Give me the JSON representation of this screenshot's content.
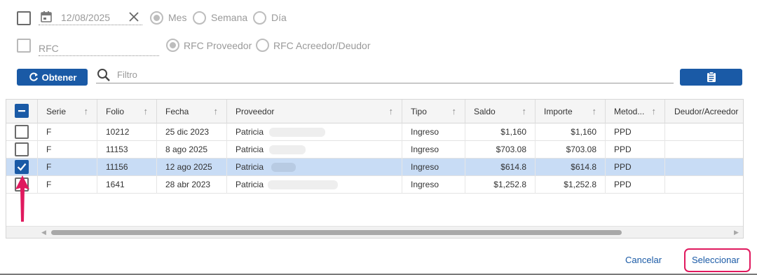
{
  "filters": {
    "date_value": "12/08/2025",
    "period_options": [
      "Mes",
      "Semana",
      "Día"
    ],
    "period_selected": "Mes",
    "rfc_placeholder": "RFC",
    "rfc_type_options": [
      "RFC Proveedor",
      "RFC Acreedor/Deudor"
    ],
    "rfc_type_selected": "RFC Proveedor"
  },
  "toolbar": {
    "obtener_label": "Obtener",
    "filter_placeholder": "Filtro"
  },
  "table": {
    "columns": [
      "Serie",
      "Folio",
      "Fecha",
      "Proveedor",
      "Tipo",
      "Saldo",
      "Importe",
      "Metod...",
      "Deudor/Acreedor"
    ],
    "rows": [
      {
        "checked": false,
        "serie": "F",
        "folio": "10212",
        "fecha": "25 dic 2023",
        "proveedor": "Patricia",
        "tipo": "Ingreso",
        "saldo": "$1,160",
        "importe": "$1,160",
        "metodo": "PPD"
      },
      {
        "checked": false,
        "serie": "F",
        "folio": "11153",
        "fecha": "8 ago 2025",
        "proveedor": "Patricia",
        "tipo": "Ingreso",
        "saldo": "$703.08",
        "importe": "$703.08",
        "metodo": "PPD"
      },
      {
        "checked": true,
        "serie": "F",
        "folio": "11156",
        "fecha": "12 ago 2025",
        "proveedor": "Patricia",
        "tipo": "Ingreso",
        "saldo": "$614.8",
        "importe": "$614.8",
        "metodo": "PPD"
      },
      {
        "checked": false,
        "serie": "F",
        "folio": "1641",
        "fecha": "28 abr 2023",
        "proveedor": "Patricia",
        "tipo": "Ingreso",
        "saldo": "$1,252.8",
        "importe": "$1,252.8",
        "metodo": "PPD"
      }
    ]
  },
  "footer": {
    "cancel_label": "Cancelar",
    "select_label": "Seleccionar"
  },
  "colors": {
    "accent": "#1a5aa6",
    "selected_row": "#c8dcf5",
    "annotation": "#e0195e"
  }
}
